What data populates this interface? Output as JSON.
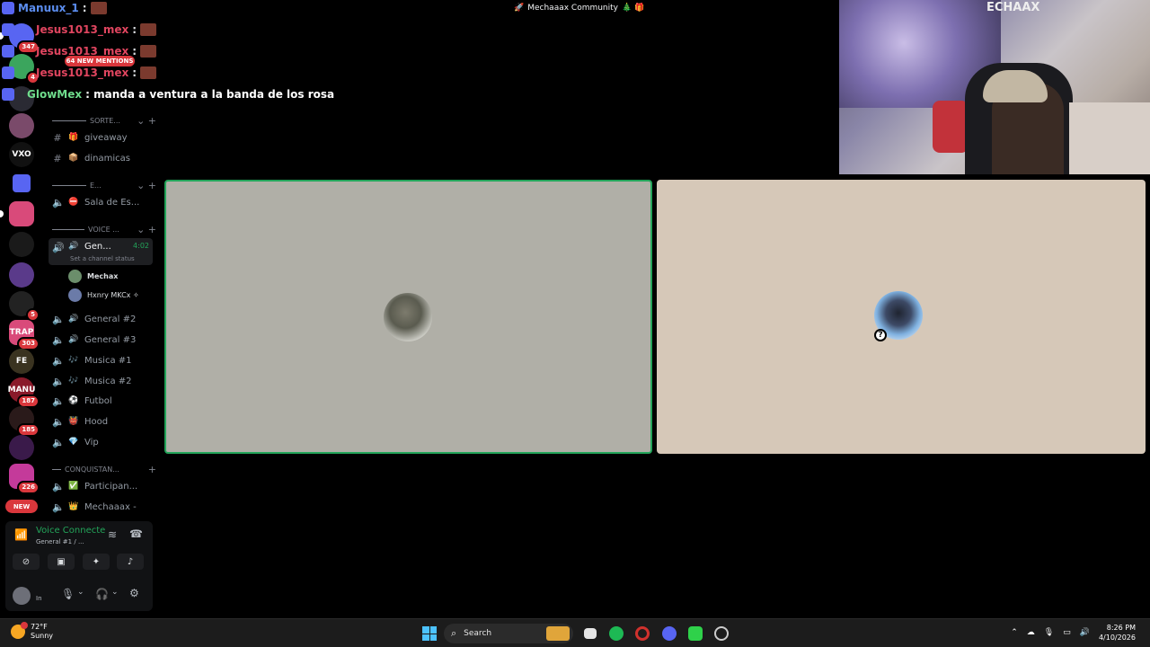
{
  "window": {
    "title": "Mechaaax Community",
    "title_prefix": "🚀",
    "title_suffix": "🎄 🎁"
  },
  "chat": {
    "lines": [
      {
        "user": "Manuux_1",
        "color": "#5b8def",
        "text": ":"
      },
      {
        "user": "Jesus1013_mex",
        "color": "#e0455f",
        "text": ":"
      },
      {
        "user": "Jesus1013_mex",
        "color": "#e0455f",
        "text": ":"
      },
      {
        "user": "Jesus1013_mex",
        "color": "#e0455f",
        "text": ":"
      },
      {
        "user": "GlowMex",
        "color": "#6fdc8c",
        "text": ": manda a ventura a la banda de los rosa"
      }
    ],
    "mentions_label": "64 NEW MENTIONS"
  },
  "rail": {
    "servers": [
      {
        "label": "",
        "badge": "347",
        "color": "#5865f2"
      },
      {
        "label": "",
        "badge": "4",
        "color": "#3ba55d"
      },
      {
        "label": "",
        "badge": "",
        "color": "#2a2a33"
      },
      {
        "label": "",
        "badge": "",
        "color": "#7a4a6a"
      },
      {
        "label": "VXO",
        "badge": "",
        "color": "#111"
      },
      {
        "label": "",
        "badge": "",
        "color": "#5865f2"
      },
      {
        "label": "",
        "badge": "",
        "color": "#d94a7a"
      },
      {
        "label": "",
        "badge": "",
        "color": "#1a1a1a"
      },
      {
        "label": "",
        "badge": "",
        "color": "#5a3a8a"
      },
      {
        "label": "",
        "badge": "5",
        "color": "#222"
      },
      {
        "label": "TRAP",
        "badge": "303",
        "color": "#d94a7a"
      },
      {
        "label": "FE",
        "badge": "",
        "color": "#3a3320"
      },
      {
        "label": "MANU",
        "badge": "187",
        "color": "#8a1a2a"
      },
      {
        "label": "",
        "badge": "185",
        "color": "#2a1a1a"
      },
      {
        "label": "",
        "badge": "",
        "color": "#3a1a4a"
      },
      {
        "label": "",
        "badge": "226",
        "color": "#c43a9a"
      }
    ],
    "new_label": "NEW"
  },
  "sidebar": {
    "categories": [
      {
        "label": "SORTE..."
      },
      {
        "label": "E..."
      },
      {
        "label": "VOICE ..."
      },
      {
        "label": "CONQUISTAN..."
      }
    ],
    "text_channels": [
      {
        "name": "giveaway",
        "emoji": "🎁"
      },
      {
        "name": "dinamicas",
        "emoji": "📦"
      }
    ],
    "stage_channel": {
      "name": "Sala de Es...",
      "emoji": "⛔"
    },
    "active_channel": {
      "name": "Gen...",
      "time": "4:02",
      "status": "Set a channel status"
    },
    "voice_users": [
      {
        "name": "Mechax",
        "color": "#6b8e6b"
      },
      {
        "name": "Hxnry MKCx ✧",
        "color": "#6b7ba8"
      }
    ],
    "voice_channels": [
      {
        "name": "General #2",
        "emoji": "🔊"
      },
      {
        "name": "General #3",
        "emoji": "🔊"
      },
      {
        "name": "Musica #1",
        "emoji": "🎶"
      },
      {
        "name": "Musica #2",
        "emoji": "🎶"
      },
      {
        "name": "Futbol",
        "emoji": "⚽"
      },
      {
        "name": "Hood",
        "emoji": "👹"
      },
      {
        "name": "Vip",
        "emoji": "💎"
      }
    ],
    "bottom_channels": [
      {
        "name": "Participan...",
        "emoji": "✅"
      },
      {
        "name": "Mechaaax -",
        "emoji": "👑"
      }
    ]
  },
  "voice_panel": {
    "title": "Voice Connecte",
    "subtitle": "General #1 / ...",
    "user_status": "In"
  },
  "webcam": {
    "letters": "ECHAAX"
  },
  "taskbar": {
    "temp": "72°F",
    "condition": "Sunny",
    "search_placeholder": "Search",
    "time": "8:26 PM",
    "date": "4/10/2026"
  },
  "colors": {
    "speaking": "#23a55a",
    "mention": "#da373c"
  }
}
